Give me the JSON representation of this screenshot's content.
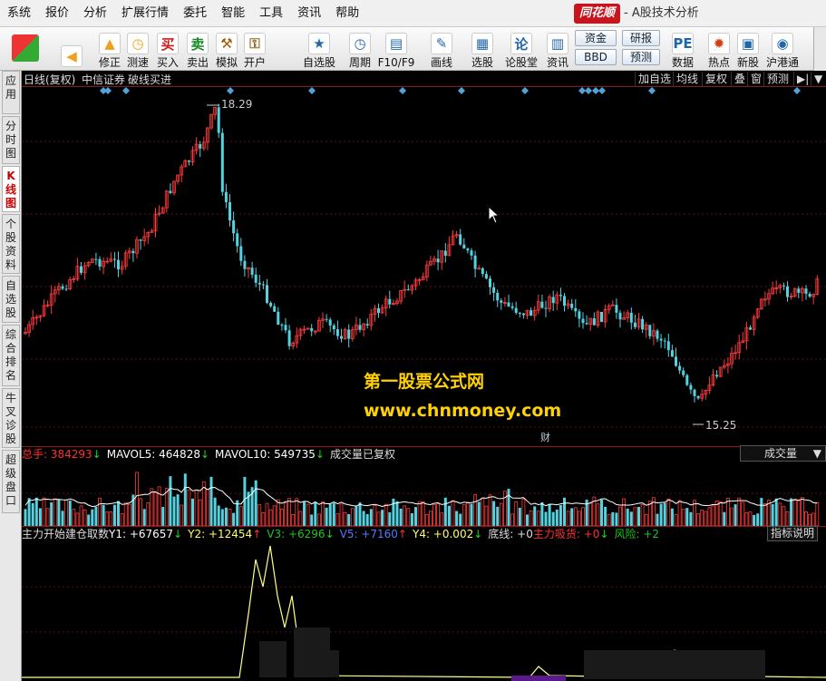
{
  "menu": [
    "系统",
    "报价",
    "分析",
    "扩展行情",
    "委托",
    "智能",
    "工具",
    "资讯",
    "帮助"
  ],
  "brand": "同花顺",
  "app_title": "- A股技术分析",
  "toolbar": {
    "buttons": [
      {
        "label": "",
        "icon": "◀",
        "color": "#f0a020"
      },
      {
        "label": "修正",
        "icon": "▲",
        "color": "#f0a020"
      },
      {
        "label": "测速",
        "icon": "◷",
        "color": "#f0a020"
      },
      {
        "label": "买入",
        "icon": "买",
        "color": "#d01818"
      },
      {
        "label": "卖出",
        "icon": "卖",
        "color": "#118822"
      },
      {
        "label": "模拟",
        "icon": "⚒",
        "color": "#aa5500"
      },
      {
        "label": "开户",
        "icon": "⚿",
        "color": "#8a6a20"
      },
      {
        "label": "自选股",
        "icon": "★",
        "color": "#2266aa"
      },
      {
        "label": "周期",
        "icon": "◷",
        "color": "#2266aa"
      },
      {
        "label": "F10/F9",
        "icon": "▤",
        "color": "#2266aa"
      },
      {
        "label": "画线",
        "icon": "✎",
        "color": "#2266aa"
      },
      {
        "label": "选股",
        "icon": "▦",
        "color": "#2266aa"
      },
      {
        "label": "论股堂",
        "icon": "论",
        "color": "#2266aa"
      },
      {
        "label": "资讯",
        "icon": "▥",
        "color": "#2266aa"
      },
      {
        "label": "数据",
        "icon": "PE",
        "color": "#2266aa"
      },
      {
        "label": "热点",
        "icon": "✹",
        "color": "#d04010"
      },
      {
        "label": "新股",
        "icon": "▣",
        "color": "#2266aa"
      },
      {
        "label": "沪港通",
        "icon": "◉",
        "color": "#2266aa"
      }
    ],
    "small_buttons": [
      "资金",
      "研报",
      "BBD",
      "预测"
    ]
  },
  "left_tabs": [
    {
      "label": "应用",
      "active": false
    },
    {
      "label": "分时图",
      "active": false
    },
    {
      "label": "K线图",
      "active": true
    },
    {
      "label": "个股资料",
      "active": false
    },
    {
      "label": "自选股",
      "active": false
    },
    {
      "label": "综合排名",
      "active": false
    },
    {
      "label": "牛叉诊股",
      "active": false
    },
    {
      "label": "超级盘口",
      "active": false
    }
  ],
  "chart_header": {
    "period": "日线(复权)",
    "stock": "中信证券",
    "indicator": "破线买进",
    "buttons": [
      "加自选",
      "均线",
      "复权",
      "叠",
      "窗",
      "预测",
      "▶|",
      "▼"
    ]
  },
  "price": {
    "high_label": "18.29",
    "low_label": "15.25",
    "cai_label": "财"
  },
  "watermark": {
    "line1": "第一股票公式网",
    "line2": "www.chnmoney.com"
  },
  "volume_title": [
    {
      "text": "总手: 384293",
      "color": "#ff3030"
    },
    {
      "text": "↓",
      "color": "#21d421"
    },
    {
      "text": "MAVOL5: 464828",
      "color": "#ffffff"
    },
    {
      "text": "↓",
      "color": "#21d421"
    },
    {
      "text": "MAVOL10: 549735",
      "color": "#ffffff"
    },
    {
      "text": "↓",
      "color": "#21d421"
    },
    {
      "text": "成交量已复权",
      "color": "#dddddd"
    }
  ],
  "volume_select": "成交量",
  "indicator_title": [
    {
      "text": "主力开始建仓取数",
      "color": "#dddddd"
    },
    {
      "text": "Y1: +67657",
      "color": "#ffffff"
    },
    {
      "text": "↓",
      "color": "#21d421"
    },
    {
      "text": "Y2: +12454",
      "color": "#ffff66"
    },
    {
      "text": "↑",
      "color": "#ff3030"
    },
    {
      "text": "V3: +6296",
      "color": "#21c421"
    },
    {
      "text": "↓",
      "color": "#21d421"
    },
    {
      "text": "V5: +7160",
      "color": "#5577ff"
    },
    {
      "text": "↑",
      "color": "#ff3030"
    },
    {
      "text": "Y4: +0.002",
      "color": "#ffff66"
    },
    {
      "text": "↓",
      "color": "#21d421"
    },
    {
      "text": "底线: +0",
      "color": "#dddddd"
    },
    {
      "text": "主力吸货: +0",
      "color": "#ff3030"
    },
    {
      "text": "↓",
      "color": "#21d421"
    },
    {
      "text": "风险: +2",
      "color": "#21c421"
    }
  ],
  "indicator_button": "指标说明",
  "colors": {
    "up": "#ff3b3b",
    "down": "#54d2e0",
    "grid": "#5a0f0f",
    "marker": "#4fa3d8",
    "ma_line": "#ffffff",
    "ind_line": "#ffff88"
  }
}
